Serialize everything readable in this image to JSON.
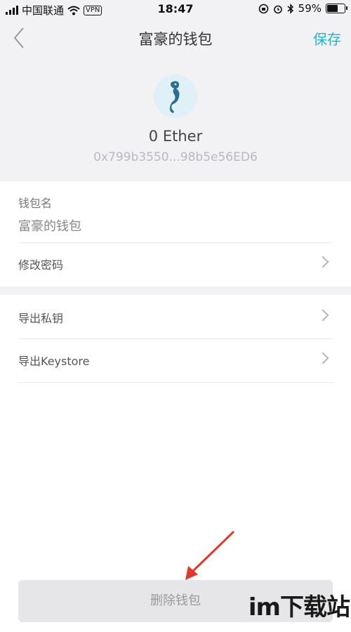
{
  "status_bar": {
    "carrier": "中国联通",
    "vpn": "VPN",
    "time": "18:47",
    "battery": "59%",
    "battery_level": 0.59
  },
  "nav": {
    "title": "富豪的钱包",
    "save_label": "保存"
  },
  "wallet": {
    "balance": "0 Ether",
    "address": "0x799b3550...98b5e56ED6"
  },
  "form": {
    "name_label": "钱包名",
    "name_value": "富豪的钱包",
    "change_password": "修改密码"
  },
  "export": {
    "private_key": "导出私钥",
    "keystore": "导出Keystore"
  },
  "delete_label": "删除钱包",
  "watermark": "im下载站",
  "colors": {
    "accent": "#20b5c4",
    "arrow": "#e0382b",
    "background": "#f2f2f4"
  }
}
